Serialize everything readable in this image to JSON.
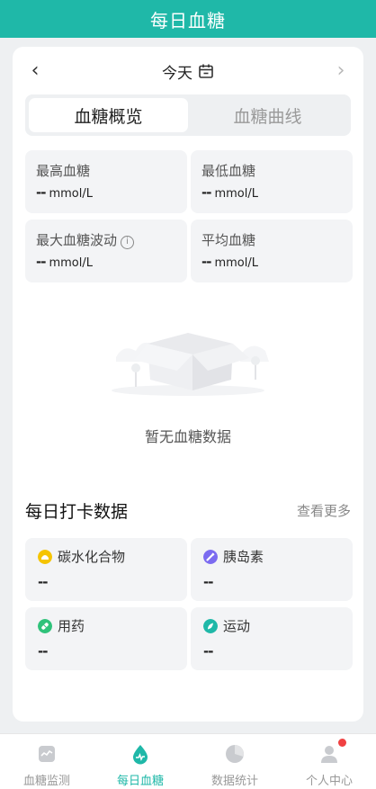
{
  "header": {
    "title": "每日血糖"
  },
  "date_nav": {
    "prev_icon": "chevron-left-icon",
    "label": "今天",
    "calendar_icon": "calendar-icon",
    "next_icon": "chevron-right-icon"
  },
  "segment": {
    "tabs": [
      "血糖概览",
      "血糖曲线"
    ],
    "active_index": 0
  },
  "stats": [
    {
      "label": "最高血糖",
      "value": "--",
      "unit": "mmol/L"
    },
    {
      "label": "最低血糖",
      "value": "--",
      "unit": "mmol/L"
    },
    {
      "label": "最大血糖波动",
      "value": "--",
      "unit": "mmol/L",
      "info_icon": "i"
    },
    {
      "label": "平均血糖",
      "value": "--",
      "unit": "mmol/L"
    }
  ],
  "empty_state": {
    "icon": "empty-box-icon",
    "text": "暂无血糖数据"
  },
  "checkin": {
    "title": "每日打卡数据",
    "more": "查看更多",
    "items": [
      {
        "label": "碳水化合物",
        "value": "--",
        "icon": "carbs-icon",
        "color": "#f5c400"
      },
      {
        "label": "胰岛素",
        "value": "--",
        "icon": "insulin-icon",
        "color": "#7b6bf0"
      },
      {
        "label": "用药",
        "value": "--",
        "icon": "medicine-icon",
        "color": "#2fc27a"
      },
      {
        "label": "运动",
        "value": "--",
        "icon": "exercise-icon",
        "color": "#1fb8a8"
      }
    ]
  },
  "tabbar": {
    "items": [
      {
        "label": "血糖监测",
        "icon": "glucose-monitor-icon"
      },
      {
        "label": "每日血糖",
        "icon": "blood-drop-icon"
      },
      {
        "label": "数据统计",
        "icon": "pie-chart-icon"
      },
      {
        "label": "个人中心",
        "icon": "user-icon"
      }
    ],
    "active_index": 1
  },
  "colors": {
    "accent": "#1fb8a8",
    "badge": "#f04142"
  }
}
